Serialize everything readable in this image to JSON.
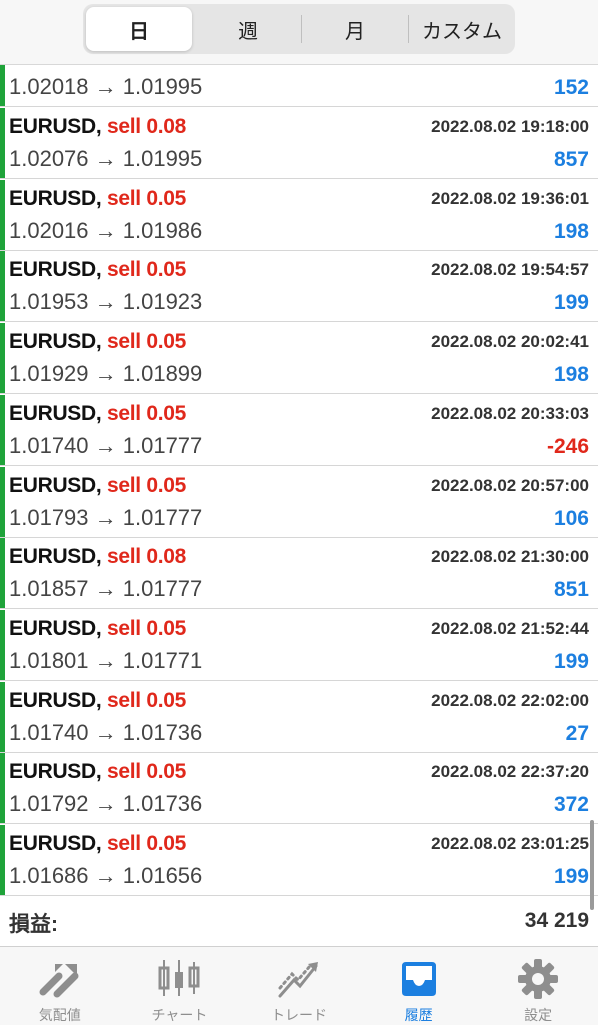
{
  "period_tabs": [
    {
      "label": "日",
      "active": true
    },
    {
      "label": "週",
      "active": false
    },
    {
      "label": "月",
      "active": false
    },
    {
      "label": "カスタム",
      "active": false
    }
  ],
  "partial_row": {
    "prices": "1.02018 → 1.01995",
    "profit": "152"
  },
  "trades": [
    {
      "symbol": "EURUSD,",
      "side": "sell 0.08",
      "time": "2022.08.02 19:18:00",
      "prices": "1.02076 → 1.01995",
      "profit": "857",
      "positive": true
    },
    {
      "symbol": "EURUSD,",
      "side": "sell 0.05",
      "time": "2022.08.02 19:36:01",
      "prices": "1.02016 → 1.01986",
      "profit": "198",
      "positive": true
    },
    {
      "symbol": "EURUSD,",
      "side": "sell 0.05",
      "time": "2022.08.02 19:54:57",
      "prices": "1.01953 → 1.01923",
      "profit": "199",
      "positive": true
    },
    {
      "symbol": "EURUSD,",
      "side": "sell 0.05",
      "time": "2022.08.02 20:02:41",
      "prices": "1.01929 → 1.01899",
      "profit": "198",
      "positive": true
    },
    {
      "symbol": "EURUSD,",
      "side": "sell 0.05",
      "time": "2022.08.02 20:33:03",
      "prices": "1.01740 → 1.01777",
      "profit": "-246",
      "positive": false
    },
    {
      "symbol": "EURUSD,",
      "side": "sell 0.05",
      "time": "2022.08.02 20:57:00",
      "prices": "1.01793 → 1.01777",
      "profit": "106",
      "positive": true
    },
    {
      "symbol": "EURUSD,",
      "side": "sell 0.08",
      "time": "2022.08.02 21:30:00",
      "prices": "1.01857 → 1.01777",
      "profit": "851",
      "positive": true
    },
    {
      "symbol": "EURUSD,",
      "side": "sell 0.05",
      "time": "2022.08.02 21:52:44",
      "prices": "1.01801 → 1.01771",
      "profit": "199",
      "positive": true
    },
    {
      "symbol": "EURUSD,",
      "side": "sell 0.05",
      "time": "2022.08.02 22:02:00",
      "prices": "1.01740 → 1.01736",
      "profit": "27",
      "positive": true
    },
    {
      "symbol": "EURUSD,",
      "side": "sell 0.05",
      "time": "2022.08.02 22:37:20",
      "prices": "1.01792 → 1.01736",
      "profit": "372",
      "positive": true
    },
    {
      "symbol": "EURUSD,",
      "side": "sell 0.05",
      "time": "2022.08.02 23:01:25",
      "prices": "1.01686 → 1.01656",
      "profit": "199",
      "positive": true
    }
  ],
  "summary": {
    "label": "損益:",
    "value": "34 219"
  },
  "bottom_tabs": [
    {
      "label": "気配値",
      "icon": "quotes-icon",
      "active": false
    },
    {
      "label": "チャート",
      "icon": "candlestick-chart-icon",
      "active": false
    },
    {
      "label": "トレード",
      "icon": "trade-trend-icon",
      "active": false
    },
    {
      "label": "履歴",
      "icon": "history-inbox-icon",
      "active": true
    },
    {
      "label": "設定",
      "icon": "gear-icon",
      "active": false
    }
  ],
  "colors": {
    "accent": "#1c7fe0",
    "loss": "#e0281b",
    "status_bar": "#1fa33a",
    "inactive": "#8e8e8e"
  }
}
